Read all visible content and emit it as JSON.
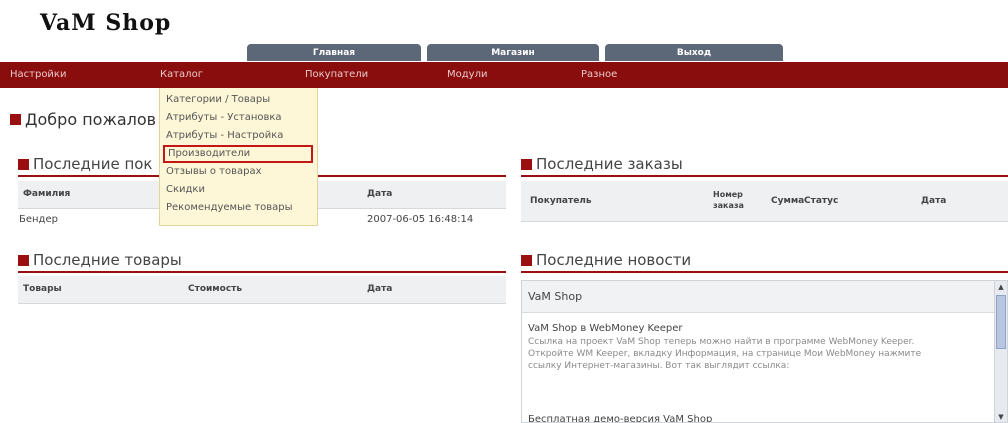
{
  "logo": "VaM Shop",
  "top_tabs": [
    "Главная",
    "Магазин",
    "Выход"
  ],
  "menu": [
    "Настройки",
    "Каталог",
    "Покупатели",
    "Модули",
    "Разное"
  ],
  "catalog_dropdown": {
    "items": [
      "Категории / Товары",
      "Атрибуты - Установка",
      "Атрибуты - Настройка",
      "Производители",
      "Отзывы о товарах",
      "Скидки",
      "Рекомендуемые товары"
    ],
    "highlighted_index": 3
  },
  "welcome": "Добро пожалов",
  "last_customers": {
    "title": "Последние пок",
    "headers": {
      "name": "Фамилия",
      "date": "Дата"
    },
    "rows": [
      {
        "name": "Бендер",
        "date": "2007-06-05 16:48:14"
      }
    ]
  },
  "last_products": {
    "title": "Последние товары",
    "headers": {
      "product": "Товары",
      "price": "Стоимость",
      "date": "Дата"
    }
  },
  "last_orders": {
    "title": "Последние заказы",
    "headers": {
      "customer": "Покупатель",
      "order_no": "Номер заказа",
      "sum": "Сумма",
      "status": "Статус",
      "date": "Дата"
    }
  },
  "last_news": {
    "title": "Последние новости",
    "feed": "VaM Shop",
    "items": [
      {
        "title": "VaM Shop в WebMoney Keeper",
        "body": "Ссылка на проект VaM Shop теперь можно найти в программе WebMoney Keeper. Откройте WM Keeper, вкладку Информация, на странице Мои WebMoney нажмите ссылку Интернет-магазины. Вот так выглядит ссылка:"
      },
      {
        "title": "Бесплатная демо-версия VaM Shop"
      }
    ]
  },
  "colors": {
    "menu_bar": "#8a0d0d",
    "accent": "#9a0f0f",
    "tab": "#5c6777",
    "dropdown_bg": "#fdf7d8"
  }
}
